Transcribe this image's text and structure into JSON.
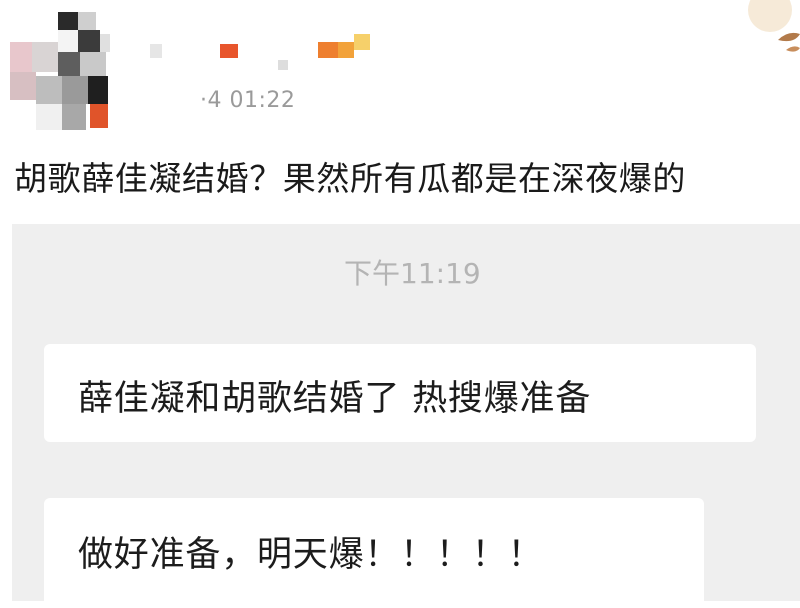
{
  "post": {
    "timestamp": "·4 01:22",
    "caption": "胡歌薛佳凝结婚？果然所有瓜都是在深夜爆的"
  },
  "chat": {
    "time_label": "下午11:19",
    "messages": [
      {
        "text": "薛佳凝和胡歌结婚了 热搜爆准备"
      },
      {
        "text": "做好准备，明天爆！！！！！"
      }
    ]
  },
  "colors": {
    "chat_background": "#efefef",
    "bubble_background": "#ffffff",
    "timestamp_text": "#9a9a9a",
    "chat_time_text": "#b4b4b4",
    "body_text": "#1a1a1a"
  }
}
